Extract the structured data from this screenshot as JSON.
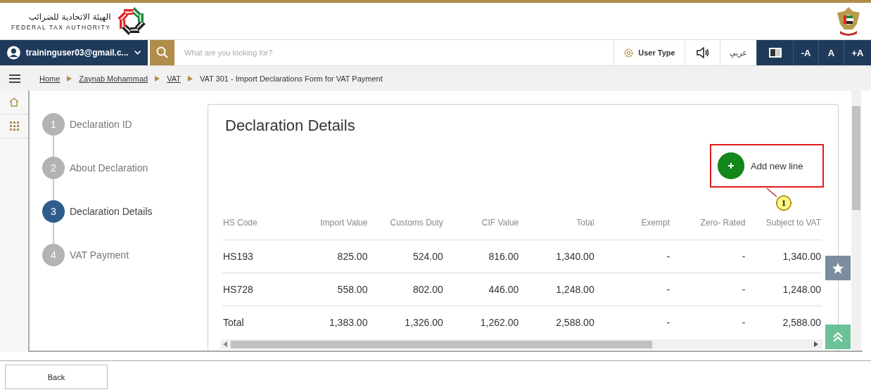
{
  "header": {
    "org_name_arabic": "الهيئة الاتحادية للضرائب",
    "org_name": "FEDERAL TAX AUTHORITY"
  },
  "nav": {
    "user_email": "traininguser03@gmail.c...",
    "search": {
      "placeholder": "What are you looking for?"
    },
    "user_type": "User Type",
    "language": "عربي",
    "font_buttons": [
      "-A",
      "A",
      "+A"
    ]
  },
  "breadcrumb": [
    {
      "label": "Home",
      "link": true
    },
    {
      "label": "Zaynab Mohammad",
      "link": true
    },
    {
      "label": "VAT",
      "link": true
    },
    {
      "label": "VAT 301 - Import Declarations Form for VAT Payment",
      "link": false
    }
  ],
  "steps": [
    {
      "number": "1",
      "label": "Declaration ID",
      "selected": false
    },
    {
      "number": "2",
      "label": "About Declaration",
      "selected": false
    },
    {
      "number": "3",
      "label": "Declaration Details",
      "selected": true
    },
    {
      "number": "4",
      "label": "VAT Payment",
      "selected": false
    }
  ],
  "card": {
    "title": "Declaration Details",
    "add_button": "Add new line",
    "callout": "1",
    "table": {
      "columns": [
        "HS Code",
        "Import Value",
        "Customs Duty",
        "CIF Value",
        "Total",
        "Exempt",
        "Zero- Rated",
        "Subject to VAT"
      ],
      "rows": [
        [
          "HS193",
          "825.00",
          "524.00",
          "816.00",
          "1,340.00",
          "-",
          "-",
          "1,340.00"
        ],
        [
          "HS728",
          "558.00",
          "802.00",
          "446.00",
          "1,248.00",
          "-",
          "-",
          "1,248.00"
        ],
        [
          "Total",
          "1,383.00",
          "1,326.00",
          "1,262.00",
          "2,588.00",
          "-",
          "-",
          "2,588.00"
        ]
      ]
    }
  },
  "back_button": "Back"
}
